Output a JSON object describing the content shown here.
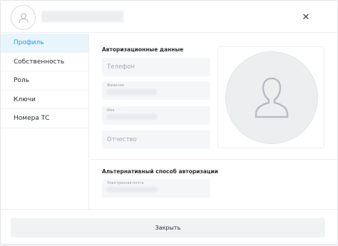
{
  "header": {
    "avatar_icon": "user-avatar-icon",
    "close_icon": "close-icon",
    "close_symbol": "✕"
  },
  "sidebar": {
    "items": [
      {
        "label": "Профиль",
        "active": true
      },
      {
        "label": "Собственность",
        "active": false
      },
      {
        "label": "Роль",
        "active": false
      },
      {
        "label": "Ключи",
        "active": false
      },
      {
        "label": "Номера ТС",
        "active": false
      }
    ]
  },
  "auth": {
    "title": "Авторизационные данные",
    "phone_placeholder": "Телефон",
    "lastname_label": "Фамилия",
    "firstname_label": "Имя",
    "patronymic_placeholder": "Отчество"
  },
  "alt_auth": {
    "title": "Альтернативный способ авторизации",
    "email_label": "Электронная почта"
  },
  "photo": {
    "icon": "user-silhouette-icon"
  },
  "footer": {
    "close_label": "Закрыть"
  },
  "colors": {
    "accent": "#1d9fe0",
    "active_bg": "#e9f5fc",
    "field_bg": "#f5f6f7"
  }
}
